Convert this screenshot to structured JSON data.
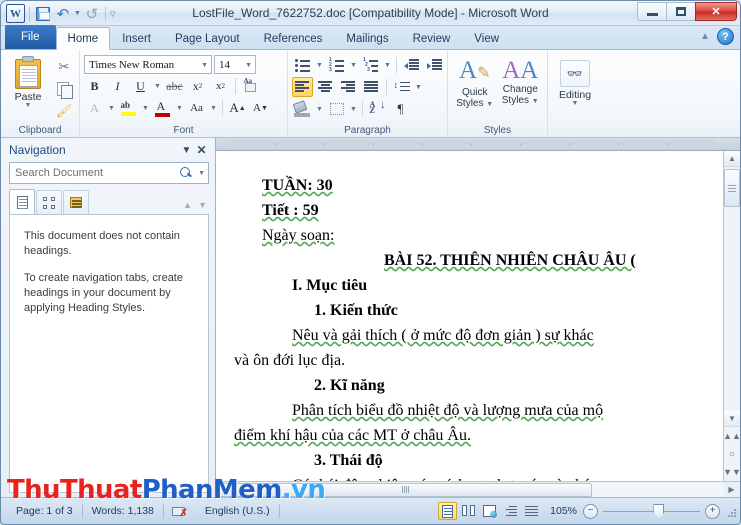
{
  "window": {
    "title": "LostFile_Word_7622752.doc [Compatibility Mode]  -  Microsoft Word",
    "app_logo": "W",
    "quick_access": [
      {
        "name": "save-icon",
        "label": "Save"
      },
      {
        "name": "undo-icon",
        "label": "Undo"
      },
      {
        "name": "redo-icon",
        "label": "Redo"
      },
      {
        "name": "customize-qat-icon",
        "label": "Customize Quick Access Toolbar"
      }
    ],
    "controls": {
      "minimize": "Minimize",
      "restore": "Restore Down",
      "close": "✕"
    }
  },
  "ribbon": {
    "tabs": [
      {
        "label": "File",
        "active": false,
        "special": true
      },
      {
        "label": "Home",
        "active": true
      },
      {
        "label": "Insert",
        "active": false
      },
      {
        "label": "Page Layout",
        "active": false
      },
      {
        "label": "References",
        "active": false
      },
      {
        "label": "Mailings",
        "active": false
      },
      {
        "label": "Review",
        "active": false
      },
      {
        "label": "View",
        "active": false
      }
    ],
    "help_icon": "help-icon",
    "minimize_ribbon_icon": "chevron-up-icon",
    "groups": {
      "clipboard": {
        "label": "Clipboard",
        "paste_label": "Paste",
        "buttons": [
          "Cut",
          "Copy",
          "Format Painter"
        ]
      },
      "font": {
        "label": "Font",
        "font_name": "Times New Roman",
        "font_size": "14",
        "bold": "B",
        "italic": "I",
        "underline": "U",
        "strikethrough": "abc",
        "subscript": "x₂",
        "superscript": "x²",
        "clear_formatting": "Aa",
        "text_effects": "A",
        "highlight": "ab",
        "font_color": "A",
        "change_case": "Aa",
        "grow_font": "A",
        "shrink_font": "A"
      },
      "paragraph": {
        "label": "Paragraph",
        "buttons": [
          "Bullets",
          "Numbering",
          "Multilevel List",
          "Decrease Indent",
          "Increase Indent",
          "Align Left",
          "Center",
          "Align Right",
          "Justify",
          "Line and Paragraph Spacing",
          "Shading",
          "Borders",
          "Sort",
          "Show/Hide"
        ],
        "active_button": "Align Left"
      },
      "styles": {
        "label": "Styles",
        "quick_styles_line1": "Quick",
        "quick_styles_line2": "Styles",
        "change_styles_line1": "Change",
        "change_styles_line2": "Styles"
      },
      "editing": {
        "label": "Editing",
        "button_label": "Editing",
        "icon": "binoculars-icon"
      }
    }
  },
  "navigation": {
    "title": "Navigation",
    "close_icon": "close-icon",
    "dropdown_icon": "chevron-down-icon",
    "search_placeholder": "Search Document",
    "search_value": "",
    "search_icon": "search-icon",
    "tabs": [
      {
        "name": "browse-headings-tab",
        "icon": "document-headings-icon",
        "active": true
      },
      {
        "name": "browse-pages-tab",
        "icon": "page-thumbnails-icon",
        "active": false
      },
      {
        "name": "browse-results-tab",
        "icon": "search-results-icon",
        "active": false
      }
    ],
    "prev_icon": "triangle-up-icon",
    "next_icon": "triangle-down-icon",
    "message_1": "This document does not contain headings.",
    "message_2": "To create navigation tabs, create headings in your document by applying Heading Styles."
  },
  "document": {
    "lines": [
      {
        "text": "TUẦN: 30",
        "bold": true,
        "indent": "i-indent"
      },
      {
        "text": "Tiết :    59",
        "bold": true,
        "indent": "i-indent"
      },
      {
        "text": "Ngày soạn:",
        "bold": false,
        "indent": "i-indent"
      },
      {
        "text": "BÀI 52.   THIÊN NHIÊN CHÂU ÂU (",
        "bold": true,
        "indent": "title-line"
      },
      {
        "text": "I.   Mục tiêu",
        "bold": true,
        "indent": "i3"
      },
      {
        "text": "1.  Kiến thức",
        "bold": true,
        "indent": "i2"
      },
      {
        "text": "Nêu và gải thích  ( ở mức độ đơn giản ) sự khác",
        "bold": false,
        "indent": "i3"
      },
      {
        "text": "và ôn đới lục địa.",
        "bold": false,
        "indent": "i4"
      },
      {
        "text": "2. Kĩ năng",
        "bold": true,
        "indent": "i2"
      },
      {
        "text": "Phân tích biểu đồ nhiệt độ và lượng mưa của mộ",
        "bold": false,
        "indent": "i3"
      },
      {
        "text": "điểm khí hậu của các MT ở châu Âu.",
        "bold": false,
        "indent": "i4"
      },
      {
        "text": "3.   Thái độ",
        "bold": true,
        "indent": "i2"
      },
      {
        "text": "Có thái độ nghiêm túc, tích cực hợp tác và phát",
        "bold": false,
        "indent": "i3"
      }
    ]
  },
  "status_bar": {
    "page": "Page: 1 of 3",
    "words": "Words: 1,138",
    "proofing_icon": "proofing-errors-icon",
    "language": "English (U.S.)",
    "view_buttons": [
      {
        "name": "print-layout-view",
        "label": "Print Layout",
        "active": true
      },
      {
        "name": "full-screen-reading-view",
        "label": "Full Screen Reading",
        "active": false
      },
      {
        "name": "web-layout-view",
        "label": "Web Layout",
        "active": false
      },
      {
        "name": "outline-view",
        "label": "Outline",
        "active": false
      },
      {
        "name": "draft-view",
        "label": "Draft",
        "active": false
      }
    ],
    "zoom_level": "105%",
    "zoom_out": "−",
    "zoom_in": "+"
  },
  "watermark": {
    "part1": "ThuThuat",
    "part2": "PhanMem",
    "part3": ".vn",
    "color1": "#e8231f",
    "color2": "#1f5fc8",
    "color3": "#3fa9f5"
  }
}
